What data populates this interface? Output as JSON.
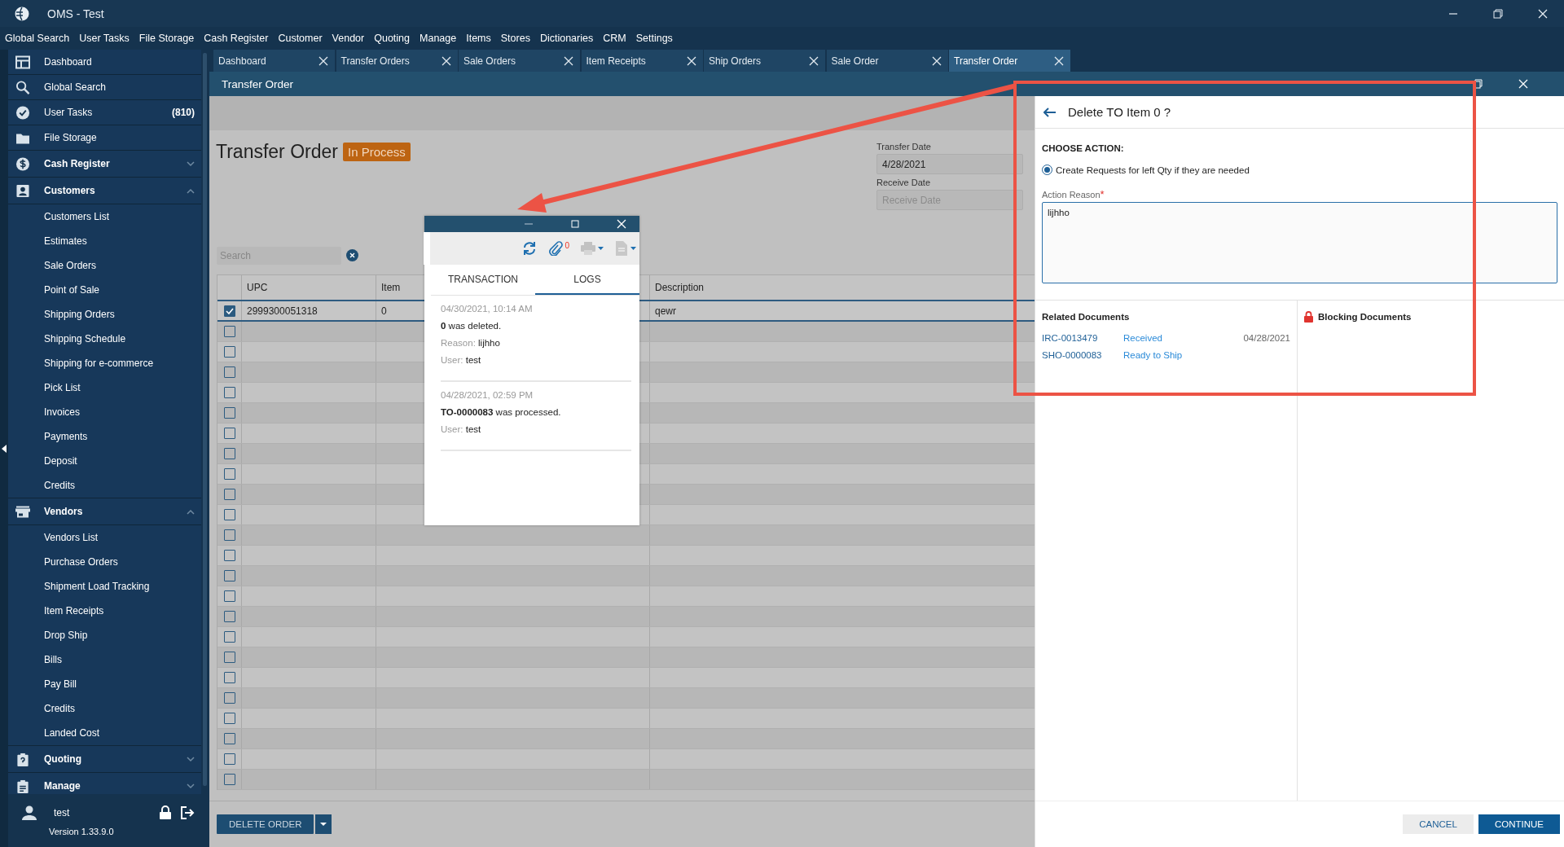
{
  "window": {
    "title": "OMS - Test"
  },
  "menu": [
    "Global Search",
    "User Tasks",
    "File Storage",
    "Cash Register",
    "Customer",
    "Vendor",
    "Quoting",
    "Manage",
    "Items",
    "Stores",
    "Dictionaries",
    "CRM",
    "Settings"
  ],
  "sidebar": {
    "items": [
      {
        "label": "Dashboard"
      },
      {
        "label": "Global Search"
      },
      {
        "label": "User Tasks",
        "badge": "(810)"
      },
      {
        "label": "File Storage"
      },
      {
        "label": "Cash Register",
        "expanded": false
      },
      {
        "label": "Customers",
        "expanded": true,
        "children": [
          "Customers List",
          "Estimates",
          "Sale Orders",
          "Point of Sale",
          "Shipping Orders",
          "Shipping Schedule",
          "Shipping for e-commerce",
          "Pick List",
          "Invoices",
          "Payments",
          "Deposit",
          "Credits"
        ]
      },
      {
        "label": "Vendors",
        "expanded": true,
        "children": [
          "Vendors List",
          "Purchase Orders",
          "Shipment Load Tracking",
          "Item Receipts",
          "Drop Ship",
          "Bills",
          "Pay Bill",
          "Credits",
          "Landed Cost"
        ]
      },
      {
        "label": "Quoting",
        "expanded": false
      },
      {
        "label": "Manage",
        "expanded": false
      }
    ],
    "user": "test",
    "version": "Version 1.33.9.0"
  },
  "tabs": [
    {
      "label": "Dashboard",
      "selected": false
    },
    {
      "label": "Transfer Orders",
      "selected": false
    },
    {
      "label": "Sale Orders",
      "selected": false
    },
    {
      "label": "Item Receipts",
      "selected": false
    },
    {
      "label": "Ship Orders",
      "selected": false
    },
    {
      "label": "Sale Order",
      "selected": false
    },
    {
      "label": "Transfer Order",
      "selected": true
    }
  ],
  "page": {
    "header": "Transfer Order",
    "title": "Transfer Order",
    "status": "In Process",
    "transfer_date": {
      "label": "Transfer Date",
      "value": "4/28/2021"
    },
    "receive_date": {
      "label": "Receive Date",
      "placeholder": "Receive Date"
    },
    "search": {
      "placeholder": "Search"
    }
  },
  "table": {
    "columns": [
      "UPC",
      "Item",
      "Description"
    ],
    "rows": [
      {
        "checked": true,
        "cells": [
          "2999300051318",
          "0",
          "qewr"
        ]
      },
      {
        "checked": false
      },
      {
        "checked": false
      },
      {
        "checked": false
      },
      {
        "checked": false
      },
      {
        "checked": false
      },
      {
        "checked": false
      },
      {
        "checked": false
      },
      {
        "checked": false
      },
      {
        "checked": false
      },
      {
        "checked": false
      },
      {
        "checked": false
      },
      {
        "checked": false
      },
      {
        "checked": false
      },
      {
        "checked": false
      },
      {
        "checked": false
      },
      {
        "checked": false
      },
      {
        "checked": false
      },
      {
        "checked": false
      },
      {
        "checked": false
      },
      {
        "checked": false
      },
      {
        "checked": false
      },
      {
        "checked": false
      },
      {
        "checked": false
      }
    ]
  },
  "bottom_buttons": [
    "DELETE ORDER"
  ],
  "popup": {
    "attachment_count": "0",
    "tabs": [
      {
        "label": "TRANSACTION",
        "selected": false
      },
      {
        "label": "LOGS",
        "selected": true
      }
    ],
    "logs": [
      {
        "time": "04/30/2021, 10:14 AM",
        "message": "**0** was deleted.",
        "fields": [
          {
            "label": "Reason:",
            "value": "lijhho"
          },
          {
            "label": "User:",
            "value": "test"
          }
        ]
      },
      {
        "time": "04/28/2021, 02:59 PM",
        "message": "**TO-0000083** was processed.",
        "fields": [
          {
            "label": "User:",
            "value": "test"
          }
        ]
      }
    ]
  },
  "dialog": {
    "title": "Delete TO Item 0 ?",
    "section": "CHOOSE ACTION:",
    "options": [
      {
        "label": "Create Requests for left Qty if they are needed",
        "selected": true
      }
    ],
    "reason": {
      "label": "Action Reason",
      "required_mark": "*",
      "value": "lijhho"
    },
    "related": {
      "title": "Related Documents",
      "rows": [
        {
          "number": "IRC-0013479",
          "status": "Received",
          "date": "04/28/2021"
        },
        {
          "number": "SHO-0000083",
          "status": "Ready to Ship"
        }
      ]
    },
    "blocking": {
      "title": "Blocking Documents"
    },
    "buttons": [
      "CANCEL",
      "CONTINUE"
    ]
  }
}
